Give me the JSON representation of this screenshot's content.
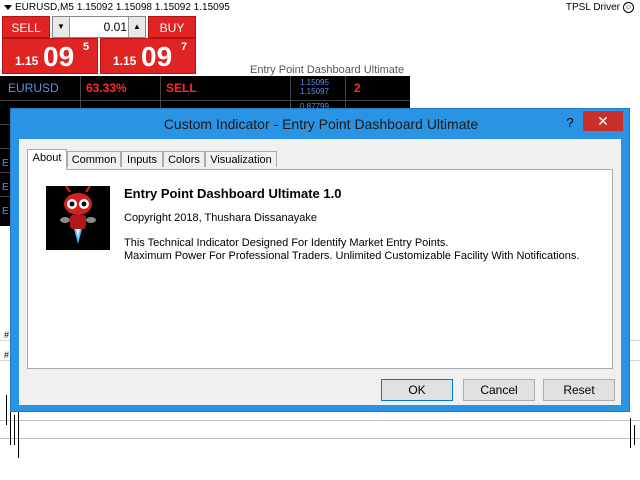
{
  "chart": {
    "symbol": "EURUSD,M5",
    "ohlc": "1.15092 1.15098 1.15092 1.15095",
    "ea_name": "TPSL Driver"
  },
  "trade_panel": {
    "sell_label": "SELL",
    "buy_label": "BUY",
    "lot": "0.01",
    "bid_small": "1.15",
    "bid_big": "09",
    "bid_sup": "5",
    "ask_small": "1.15",
    "ask_big": "09",
    "ask_sup": "7"
  },
  "dashboard": {
    "title": "Entry Point Dashboard Ultimate",
    "row1": {
      "pair": "EURUSD",
      "percent": "63.33%",
      "signal": "SELL",
      "price1": "1.15095",
      "price2": "1.15097",
      "count": "2"
    },
    "row2_price": "0.87799",
    "left_letters": [
      "E",
      "E",
      "E",
      "E",
      "E"
    ]
  },
  "dialog": {
    "title": "Custom Indicator - Entry Point Dashboard Ultimate",
    "help": "?",
    "close": "✕",
    "tabs": [
      "About",
      "Common",
      "Inputs",
      "Colors",
      "Visualization"
    ],
    "indicator_name": "Entry Point Dashboard Ultimate 1.0",
    "copyright": "Copyright 2018, Thushara Dissanayake",
    "description_line1": "This Technical Indicator Designed For Identify Market Entry Points.",
    "description_line2": "Maximum Power For Professional Traders. Unlimited Customizable Facility With Notifications.",
    "ok": "OK",
    "cancel": "Cancel",
    "reset": "Reset"
  },
  "colors": {
    "sell_red": "#e02424",
    "dialog_blue": "#2b93e3",
    "close_red": "#c9302c"
  }
}
